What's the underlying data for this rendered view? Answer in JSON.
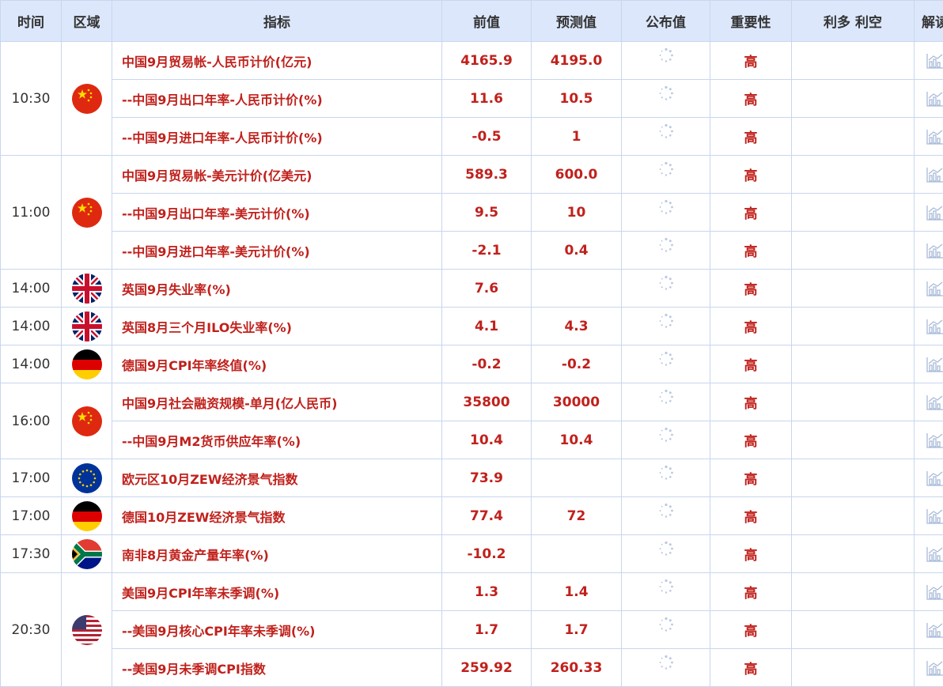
{
  "header": {
    "time": "时间",
    "region": "区域",
    "indicator": "指标",
    "previous": "前值",
    "forecast": "预测值",
    "actual": "公布值",
    "importance": "重要性",
    "bull_bear": "利多 利空",
    "interpret": "解读"
  },
  "groups": [
    {
      "time": "10:30",
      "flag": "china-flag",
      "rows": [
        {
          "name": "中国9月贸易帐-人民币计价(亿元)",
          "prev": "4165.9",
          "fcst": "4195.0",
          "imp": "高"
        },
        {
          "name": "--中国9月出口年率-人民币计价(%)",
          "prev": "11.6",
          "fcst": "10.5",
          "imp": "高"
        },
        {
          "name": "--中国9月进口年率-人民币计价(%)",
          "prev": "-0.5",
          "fcst": "1",
          "imp": "高"
        }
      ]
    },
    {
      "time": "11:00",
      "flag": "china-flag",
      "rows": [
        {
          "name": "中国9月贸易帐-美元计价(亿美元)",
          "prev": "589.3",
          "fcst": "600.0",
          "imp": "高"
        },
        {
          "name": "--中国9月出口年率-美元计价(%)",
          "prev": "9.5",
          "fcst": "10",
          "imp": "高"
        },
        {
          "name": "--中国9月进口年率-美元计价(%)",
          "prev": "-2.1",
          "fcst": "0.4",
          "imp": "高"
        }
      ]
    },
    {
      "time": "14:00",
      "flag": "uk-flag",
      "rows": [
        {
          "name": "英国9月失业率(%)",
          "prev": "7.6",
          "fcst": "",
          "imp": "高"
        }
      ]
    },
    {
      "time": "14:00",
      "flag": "uk-flag",
      "rows": [
        {
          "name": "英国8月三个月ILO失业率(%)",
          "prev": "4.1",
          "fcst": "4.3",
          "imp": "高"
        }
      ]
    },
    {
      "time": "14:00",
      "flag": "germany-flag",
      "rows": [
        {
          "name": "德国9月CPI年率终值(%)",
          "prev": "-0.2",
          "fcst": "-0.2",
          "imp": "高"
        }
      ]
    },
    {
      "time": "16:00",
      "flag": "china-flag",
      "rows": [
        {
          "name": "中国9月社会融资规模-单月(亿人民币)",
          "prev": "35800",
          "fcst": "30000",
          "imp": "高"
        },
        {
          "name": "--中国9月M2货币供应年率(%)",
          "prev": "10.4",
          "fcst": "10.4",
          "imp": "高"
        }
      ]
    },
    {
      "time": "17:00",
      "flag": "eu-flag",
      "rows": [
        {
          "name": "欧元区10月ZEW经济景气指数",
          "prev": "73.9",
          "fcst": "",
          "imp": "高"
        }
      ]
    },
    {
      "time": "17:00",
      "flag": "germany-flag",
      "rows": [
        {
          "name": "德国10月ZEW经济景气指数",
          "prev": "77.4",
          "fcst": "72",
          "imp": "高"
        }
      ]
    },
    {
      "time": "17:30",
      "flag": "south-africa-flag",
      "rows": [
        {
          "name": "南非8月黄金产量年率(%)",
          "prev": "-10.2",
          "fcst": "",
          "imp": "高"
        }
      ]
    },
    {
      "time": "20:30",
      "flag": "usa-flag",
      "rows": [
        {
          "name": "美国9月CPI年率未季调(%)",
          "prev": "1.3",
          "fcst": "1.4",
          "imp": "高"
        },
        {
          "name": "--美国9月核心CPI年率未季调(%)",
          "prev": "1.7",
          "fcst": "1.7",
          "imp": "高"
        },
        {
          "name": "--美国9月未季调CPI指数",
          "prev": "259.92",
          "fcst": "260.33",
          "imp": "高"
        }
      ]
    }
  ],
  "colors": {
    "header_bg": "#dce7fb",
    "border": "#c8d6ee",
    "accent_red": "#c0211c"
  }
}
